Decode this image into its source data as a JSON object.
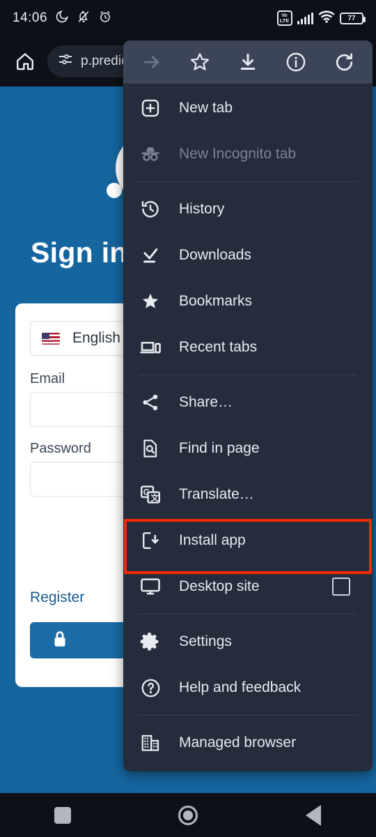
{
  "status_bar": {
    "time": "14:06",
    "icons": [
      "moon-icon",
      "bell-muted-icon",
      "alarm-icon"
    ],
    "network_label_top": "Vo",
    "network_label_bottom": "LTE",
    "battery_level": "77"
  },
  "toolbar": {
    "home_icon": "home-icon",
    "url_text": "p.predic",
    "page_info_icon": "tune-icon"
  },
  "page": {
    "heading": "Sign in",
    "language_value": "English",
    "email_label": "Email",
    "email_value": "",
    "password_label": "Password",
    "password_value": "",
    "register_link": "Register",
    "submit_icon": "lock-icon"
  },
  "menu": {
    "top_actions": [
      {
        "name": "forward-button",
        "icon": "arrow-right-icon",
        "disabled": true
      },
      {
        "name": "bookmark-button",
        "icon": "star-outline-icon",
        "disabled": false
      },
      {
        "name": "download-button",
        "icon": "download-icon",
        "disabled": false
      },
      {
        "name": "page-info-button",
        "icon": "info-icon",
        "disabled": false
      },
      {
        "name": "reload-button",
        "icon": "reload-icon",
        "disabled": false
      }
    ],
    "items": [
      {
        "label": "New tab",
        "icon": "new-tab-icon",
        "disabled": false
      },
      {
        "label": "New Incognito tab",
        "icon": "incognito-icon",
        "disabled": true
      },
      {
        "label": "History",
        "icon": "history-icon",
        "disabled": false
      },
      {
        "label": "Downloads",
        "icon": "downloads-icon",
        "disabled": false
      },
      {
        "label": "Bookmarks",
        "icon": "star-filled-icon",
        "disabled": false
      },
      {
        "label": "Recent tabs",
        "icon": "recent-tabs-icon",
        "disabled": false
      },
      {
        "label": "Share…",
        "icon": "share-icon",
        "disabled": false
      },
      {
        "label": "Find in page",
        "icon": "find-in-page-icon",
        "disabled": false
      },
      {
        "label": "Translate…",
        "icon": "translate-icon",
        "disabled": false
      },
      {
        "label": "Install app",
        "icon": "install-app-icon",
        "disabled": false
      },
      {
        "label": "Desktop site",
        "icon": "desktop-icon",
        "disabled": false,
        "checkbox": "unchecked"
      },
      {
        "label": "Settings",
        "icon": "gear-icon",
        "disabled": false
      },
      {
        "label": "Help and feedback",
        "icon": "help-icon",
        "disabled": false
      },
      {
        "label": "Managed browser",
        "icon": "building-icon",
        "disabled": false
      }
    ],
    "highlighted_item": "Install app",
    "highlight_color": "#f5290a"
  },
  "nav_bar": {
    "recents": "square-icon",
    "home": "circle-icon",
    "back": "triangle-back-icon"
  },
  "colors": {
    "page_blue": "#15659f",
    "menu_bg": "#252c3b",
    "menu_top_bg": "#3c4457",
    "system_bg": "#0d1117"
  }
}
